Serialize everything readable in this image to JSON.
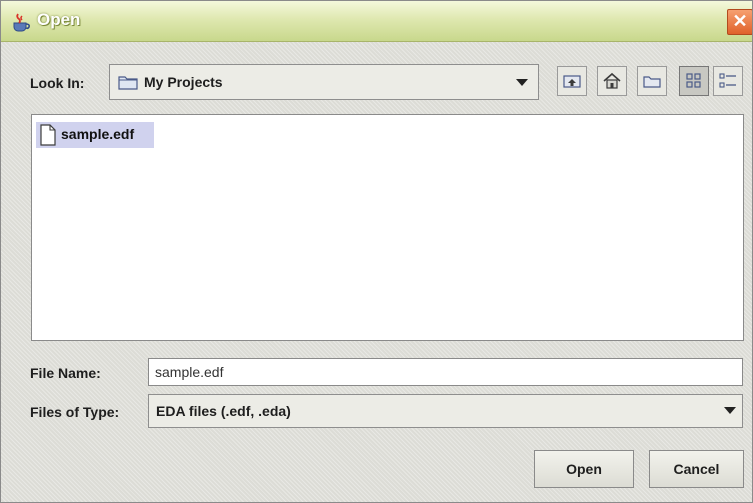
{
  "window": {
    "title": "Open",
    "close_symbol": "✕"
  },
  "look_in": {
    "label": "Look In:",
    "value": "My Projects",
    "folder_icon": "folder-icon"
  },
  "toolbar": {
    "buttons": [
      {
        "name": "up-one-level",
        "icon": "up-folder-icon"
      },
      {
        "name": "home",
        "icon": "home-icon"
      },
      {
        "name": "new-folder",
        "icon": "new-folder-icon"
      },
      {
        "name": "list-view",
        "icon": "list-view-icon",
        "selected": true
      },
      {
        "name": "details-view",
        "icon": "details-view-icon"
      }
    ]
  },
  "files": [
    {
      "name": "sample.edf",
      "icon": "document-icon",
      "selected": true
    }
  ],
  "file_name": {
    "label": "File Name:",
    "value": "sample.edf"
  },
  "file_type": {
    "label": "Files of Type:",
    "value": "EDA files (.edf, .eda)"
  },
  "buttons": {
    "open": "Open",
    "cancel": "Cancel"
  },
  "colors": {
    "selection": "#d0d2ee",
    "title_gradient_top": "#f4f8dc",
    "title_gradient_bottom": "#c8d88c",
    "close_button": "#e0612a"
  }
}
